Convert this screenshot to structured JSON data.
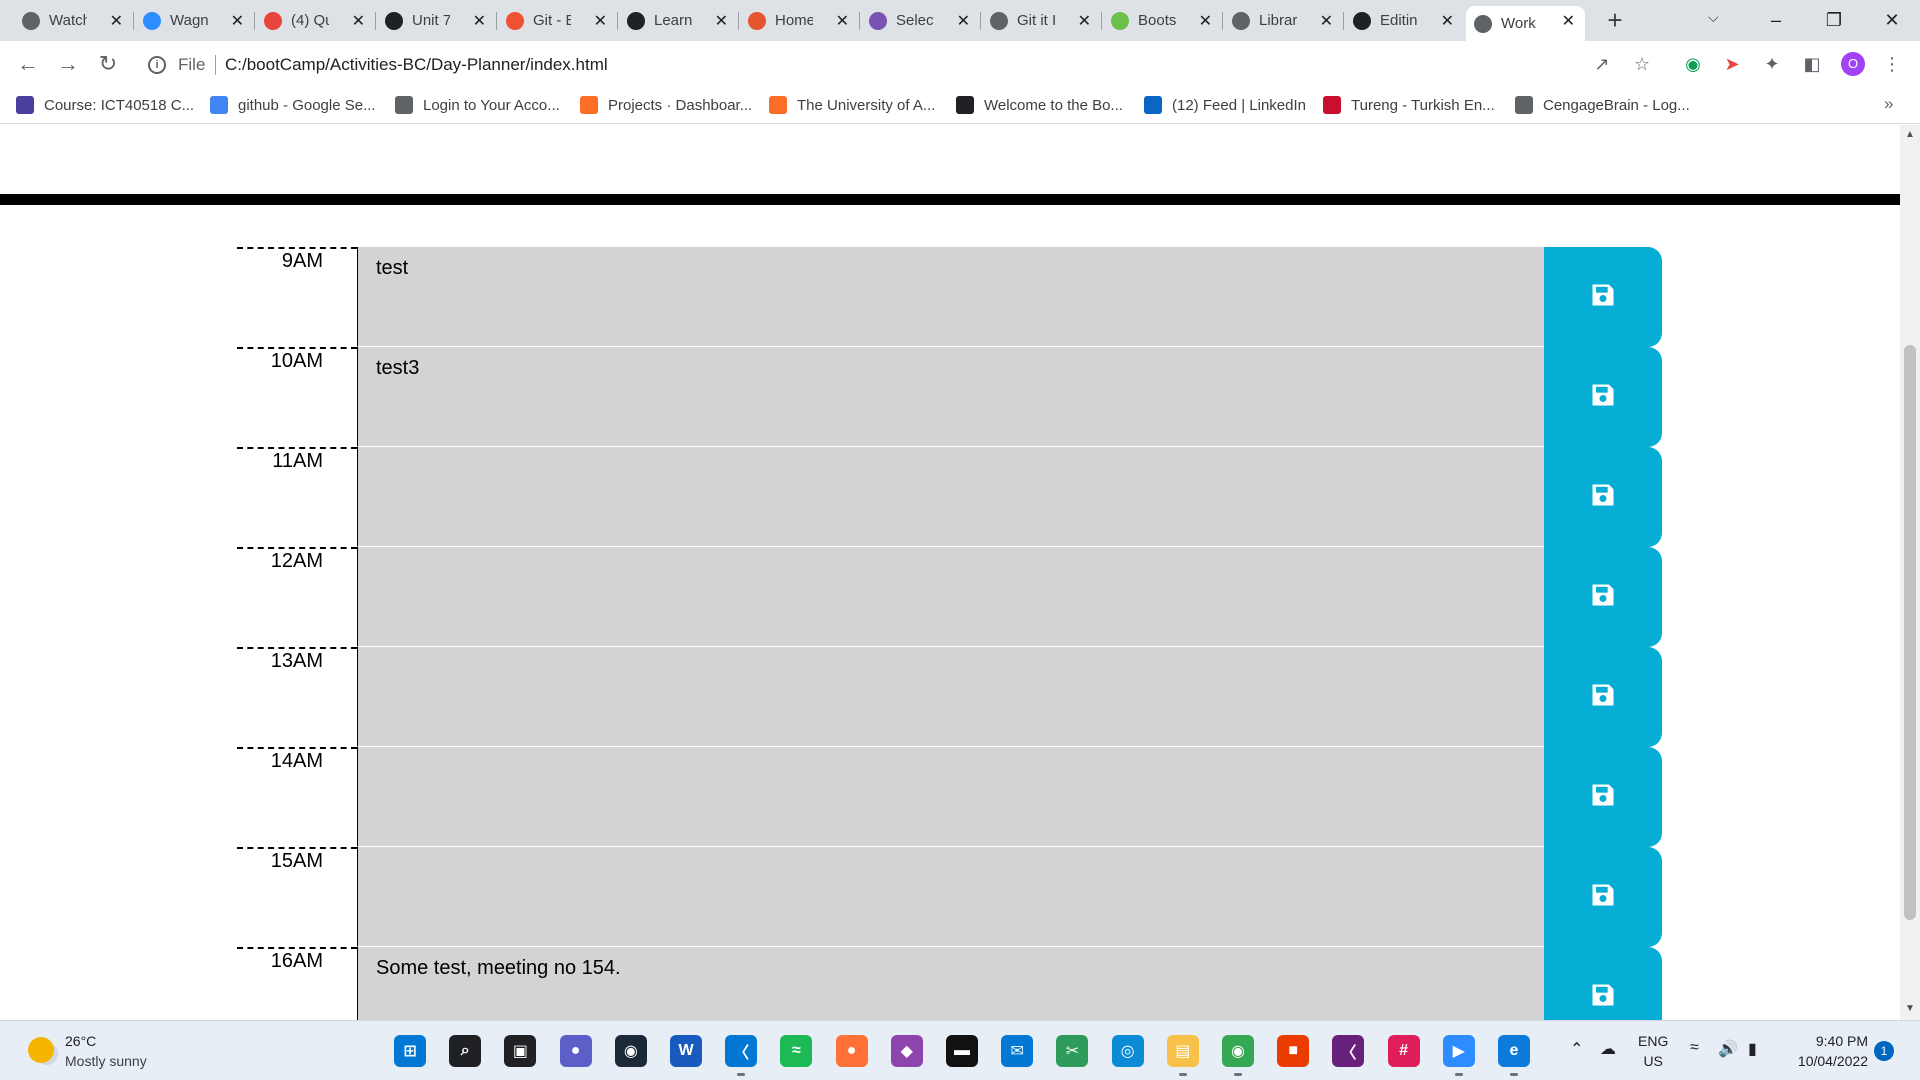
{
  "browser": {
    "tabs": [
      {
        "title": "Watch",
        "favicon": "globe-icon",
        "color": "#5f6368"
      },
      {
        "title": "Wagn",
        "favicon": "zoom-icon",
        "color": "#2d8cff"
      },
      {
        "title": "(4) Qu",
        "favicon": "g-icon",
        "color": "#e8453c"
      },
      {
        "title": "Unit 7",
        "favicon": "book-icon",
        "color": "#202124"
      },
      {
        "title": "Git - E",
        "favicon": "git-icon",
        "color": "#f05133"
      },
      {
        "title": "Learn",
        "favicon": "lt-icon",
        "color": "#202124"
      },
      {
        "title": "Home",
        "favicon": "uc-icon",
        "color": "#e4572e"
      },
      {
        "title": "Select",
        "favicon": "bootstrap-icon",
        "color": "#7952b3"
      },
      {
        "title": "Git it I",
        "favicon": "globe-icon",
        "color": "#5f6368"
      },
      {
        "title": "Boots",
        "favicon": "vuetify-icon",
        "color": "#6cc04a"
      },
      {
        "title": "Librar",
        "favicon": "globe-icon",
        "color": "#5f6368"
      },
      {
        "title": "Editin",
        "favicon": "github-icon",
        "color": "#202124"
      },
      {
        "title": "Work",
        "favicon": "globe-icon",
        "color": "#5f6368"
      }
    ],
    "new_tab": "+",
    "address": {
      "scheme_label": "File",
      "url": "C:/bootCamp/Activities-BC/Day-Planner/index.html"
    },
    "profile_initial": "O",
    "bookmarks": [
      {
        "label": "Course: ICT40518 C...",
        "icon": "course-icon",
        "color": "#4b3f9e"
      },
      {
        "label": "github - Google Se...",
        "icon": "google-icon",
        "color": "#4285f4"
      },
      {
        "label": "Login to Your Acco...",
        "icon": "globe-icon",
        "color": "#5f6368"
      },
      {
        "label": "Projects · Dashboar...",
        "icon": "gitlab-icon",
        "color": "#fc6d26"
      },
      {
        "label": "The University of A...",
        "icon": "gitlab-icon",
        "color": "#fc6d26"
      },
      {
        "label": "Welcome to the Bo...",
        "icon": "book-icon",
        "color": "#202124"
      },
      {
        "label": "(12) Feed | LinkedIn",
        "icon": "linkedin-icon",
        "color": "#0a66c2"
      },
      {
        "label": "Tureng - Turkish En...",
        "icon": "tureng-icon",
        "color": "#c8102e"
      },
      {
        "label": "CengageBrain - Log...",
        "icon": "globe-icon",
        "color": "#5f6368"
      }
    ],
    "bookmarks_more": "»"
  },
  "planner": {
    "accent_color": "#06aed5",
    "row_color": "#d3d3d3",
    "rows": [
      {
        "hour": "9AM",
        "text": "test"
      },
      {
        "hour": "10AM",
        "text": "test3"
      },
      {
        "hour": "11AM",
        "text": ""
      },
      {
        "hour": "12AM",
        "text": ""
      },
      {
        "hour": "13AM",
        "text": ""
      },
      {
        "hour": "14AM",
        "text": ""
      },
      {
        "hour": "15AM",
        "text": ""
      },
      {
        "hour": "16AM",
        "text": "Some test, meeting no 154."
      }
    ]
  },
  "taskbar": {
    "weather": {
      "temp": "26°C",
      "desc": "Mostly sunny"
    },
    "apps": [
      {
        "name": "windows-start-icon",
        "color": "#0078d4"
      },
      {
        "name": "search-icon",
        "color": "#202124"
      },
      {
        "name": "task-view-icon",
        "color": "#202124"
      },
      {
        "name": "chat-icon",
        "color": "#5b5fc7"
      },
      {
        "name": "steam-icon",
        "color": "#1b2838"
      },
      {
        "name": "word-icon",
        "color": "#185abd"
      },
      {
        "name": "vscode-icon",
        "color": "#0078d4"
      },
      {
        "name": "spotify-icon",
        "color": "#1db954"
      },
      {
        "name": "firefox-icon",
        "color": "#ff7139"
      },
      {
        "name": "gitkraken-icon",
        "color": "#8e44ad"
      },
      {
        "name": "terminal-icon",
        "color": "#111111"
      },
      {
        "name": "mail-icon",
        "color": "#0078d4"
      },
      {
        "name": "snip-icon",
        "color": "#2e9b5b"
      },
      {
        "name": "vpn-icon",
        "color": "#0b8bd6"
      },
      {
        "name": "file-explorer-icon",
        "color": "#f8c14a"
      },
      {
        "name": "chrome-icon",
        "color": "#34a853"
      },
      {
        "name": "office-icon",
        "color": "#eb3c00"
      },
      {
        "name": "visual-studio-icon",
        "color": "#68217a"
      },
      {
        "name": "slack-icon",
        "color": "#e01e5a"
      },
      {
        "name": "zoom-icon",
        "color": "#2d8cff"
      },
      {
        "name": "edge-icon",
        "color": "#0c7bdc"
      }
    ],
    "language": {
      "line1": "ENG",
      "line2": "US"
    },
    "clock": {
      "time": "9:40 PM",
      "date": "10/04/2022"
    },
    "notifications": "1"
  }
}
